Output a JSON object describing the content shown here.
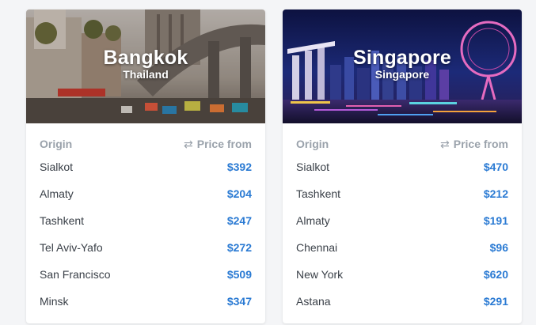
{
  "header": {
    "origin_label": "Origin",
    "price_label": "Price from",
    "swap_icon": "swap-arrows-icon"
  },
  "cards": [
    {
      "city": "Bangkok",
      "country": "Thailand",
      "rows": [
        {
          "origin": "Sialkot",
          "price": "$392"
        },
        {
          "origin": "Almaty",
          "price": "$204"
        },
        {
          "origin": "Tashkent",
          "price": "$247"
        },
        {
          "origin": "Tel Aviv-Yafo",
          "price": "$272"
        },
        {
          "origin": "San Francisco",
          "price": "$509"
        },
        {
          "origin": "Minsk",
          "price": "$347"
        }
      ]
    },
    {
      "city": "Singapore",
      "country": "Singapore",
      "rows": [
        {
          "origin": "Sialkot",
          "price": "$470"
        },
        {
          "origin": "Tashkent",
          "price": "$212"
        },
        {
          "origin": "Almaty",
          "price": "$191"
        },
        {
          "origin": "Chennai",
          "price": "$96"
        },
        {
          "origin": "New York",
          "price": "$620"
        },
        {
          "origin": "Astana",
          "price": "$291"
        }
      ]
    }
  ],
  "colors": {
    "price": "#2a7ad3",
    "header_text": "#9aa2ab",
    "origin_text": "#3a4048"
  }
}
